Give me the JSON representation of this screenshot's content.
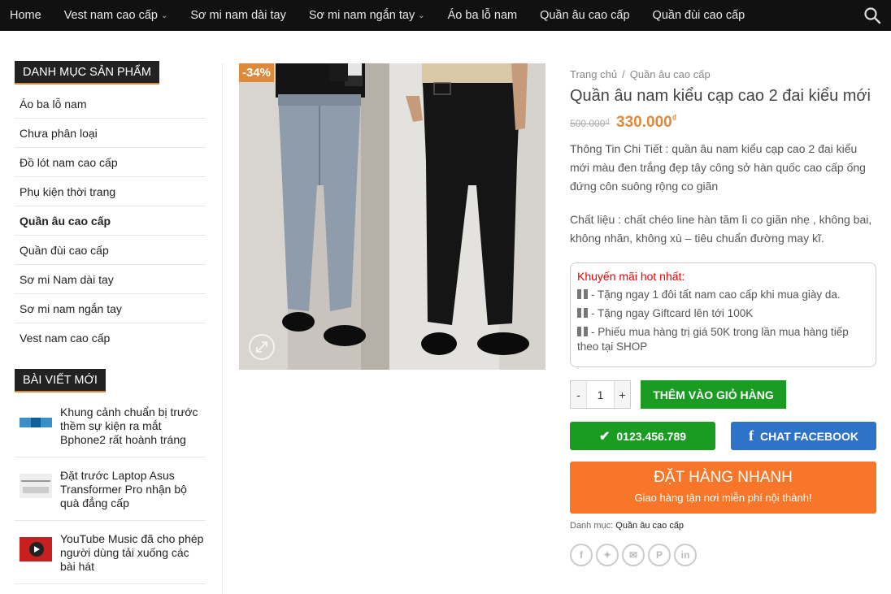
{
  "nav": {
    "items": [
      {
        "label": "Home",
        "has_dropdown": false
      },
      {
        "label": "Vest nam cao cấp",
        "has_dropdown": true
      },
      {
        "label": "Sơ mi nam dài tay",
        "has_dropdown": false
      },
      {
        "label": "Sơ mi nam ngắn tay",
        "has_dropdown": true
      },
      {
        "label": "Áo ba lỗ nam",
        "has_dropdown": false
      },
      {
        "label": "Quần âu cao cấp",
        "has_dropdown": false
      },
      {
        "label": "Quần đùi cao cấp",
        "has_dropdown": false
      }
    ],
    "search_icon": "search-icon",
    "dropdown_icon": "chevron-down-icon"
  },
  "sidebar": {
    "categories_title": "DANH MỤC SẢN PHẨM",
    "categories": [
      {
        "label": "Áo ba lỗ nam",
        "active": false
      },
      {
        "label": "Chưa phân loại",
        "active": false
      },
      {
        "label": "Đồ lót nam cao cấp",
        "active": false
      },
      {
        "label": "Phụ kiện thời trang",
        "active": false
      },
      {
        "label": "Quần âu cao cấp",
        "active": true
      },
      {
        "label": "Quần đùi cao cấp",
        "active": false
      },
      {
        "label": "Sơ mi Nam dài tay",
        "active": false
      },
      {
        "label": "Sơ mi nam ngắn tay",
        "active": false
      },
      {
        "label": "Vest nam cao cấp",
        "active": false
      }
    ],
    "posts_title": "BÀI VIẾT MỚI",
    "posts": [
      {
        "title": "Khung cảnh chuẩn bị trước thềm sự kiện ra mắt Bphone2 rất hoành tráng"
      },
      {
        "title": "Đặt trước Laptop Asus Transformer Pro nhận bộ quà đẳng cấp"
      },
      {
        "title": "YouTube Music đã cho phép người dùng tải xuống các bài hát"
      }
    ]
  },
  "product": {
    "discount_badge": "-34%",
    "zoom_icon": "expand-icon",
    "breadcrumb": {
      "home": "Trang chủ",
      "separator": "/",
      "category": "Quần âu cao cấp"
    },
    "title": "Quần âu nam kiểu cạp cao 2 đai kiểu mới",
    "old_price": "500.000",
    "new_price": "330.000",
    "currency": "₫",
    "description": "Thông Tin Chi Tiết : quần âu nam kiểu cạp cao 2 đai kiểu mới màu đen trắng đẹp tây công sở hàn quốc cao cấp ống đứng côn suông rộng co giãn",
    "material": "Chất liệu : chất chéo line hàn tăm lì co giãn nhẹ , không bai, không nhăn, không xù – tiêu chuẩn đường may kĩ.",
    "promo": {
      "title": "Khuyến mãi hot nhất:",
      "icon": "gift-icon",
      "lines": [
        "- Tặng ngay 1 đôi tất nam cao cấp khi mua giày da.",
        "- Tặng ngay Giftcard lên tới 100K",
        "- Phiếu mua hàng trị giá 50K trong lần mua hàng tiếp theo tại SHOP"
      ]
    },
    "quantity": {
      "minus": "-",
      "value": "1",
      "plus": "+"
    },
    "add_to_cart": "THÊM VÀO GIỎ HÀNG",
    "phone": {
      "icon": "check-icon",
      "label": "0123.456.789"
    },
    "facebook": {
      "icon": "facebook-icon",
      "label": "CHAT FACEBOOK"
    },
    "order": {
      "label": "ĐẶT HÀNG NHANH",
      "sub": "Giao hàng tận nơi miễn phí nội thành!"
    },
    "category_label": "Danh mục:",
    "category_value": "Quần âu cao cấp",
    "share_icons": [
      "facebook-icon",
      "twitter-icon",
      "email-icon",
      "pinterest-icon",
      "linkedin-icon"
    ]
  },
  "colors": {
    "nav_bg": "#111111",
    "accent": "#dd8a3a",
    "green": "#1a9c23",
    "facebook_blue": "#2f73c8",
    "order_orange": "#f7762a",
    "promo_red": "#ee0000"
  }
}
